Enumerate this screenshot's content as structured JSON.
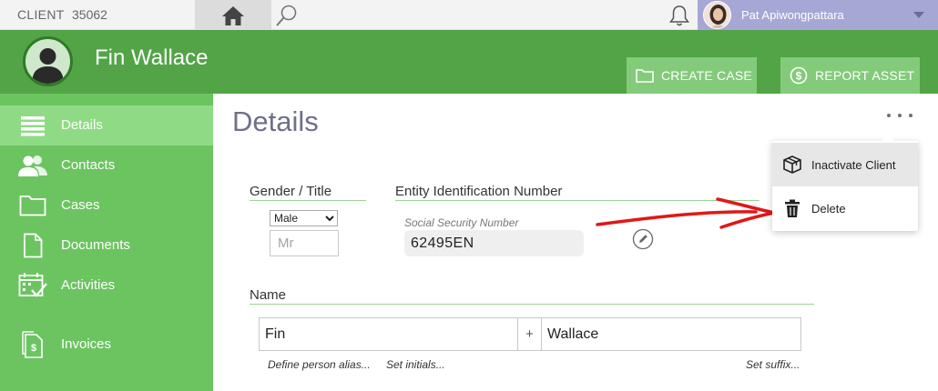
{
  "topbar": {
    "client_label": "CLIENT",
    "client_id": "35062",
    "user_name": "Pat Apiwongpattara",
    "icons": {
      "home": "home-icon",
      "search": "search-icon",
      "bell": "bell-icon",
      "caret": "chevron-down-icon"
    }
  },
  "header": {
    "client_name": "Fin Wallace",
    "create_case_label": "CREATE CASE",
    "report_asset_label": "REPORT ASSET",
    "colors": {
      "header_bg": "#52a447",
      "button_bg": "#83cb7a"
    }
  },
  "sidebar": {
    "items": [
      {
        "label": "Details",
        "icon": "list-icon",
        "active": true
      },
      {
        "label": "Contacts",
        "icon": "contacts-icon",
        "active": false
      },
      {
        "label": "Cases",
        "icon": "folder-icon",
        "active": false
      },
      {
        "label": "Documents",
        "icon": "document-icon",
        "active": false
      },
      {
        "label": "Activities",
        "icon": "calendar-check-icon",
        "active": false
      },
      {
        "label": "Invoices",
        "icon": "invoice-icon",
        "active": false
      }
    ],
    "colors": {
      "bg": "#6cc461",
      "active_bg": "#8fdb85"
    }
  },
  "main": {
    "page_title": "Details",
    "gender_title": {
      "label": "Gender / Title",
      "gender_selected": "Male",
      "title_placeholder": "Mr"
    },
    "entity_id": {
      "label": "Entity Identification Number",
      "ssn_label": "Social Security Number",
      "ssn_value": "62495EN"
    },
    "name": {
      "label": "Name",
      "first": "Fin",
      "separator": "+",
      "last": "Wallace",
      "alias_link": "Define person alias...",
      "initials_link": "Set initials...",
      "suffix_link": "Set suffix..."
    }
  },
  "menu": {
    "items": [
      {
        "label": "Inactivate Client",
        "icon": "box-icon",
        "highlighted": true
      },
      {
        "label": "Delete",
        "icon": "trash-icon",
        "highlighted": false
      }
    ]
  }
}
